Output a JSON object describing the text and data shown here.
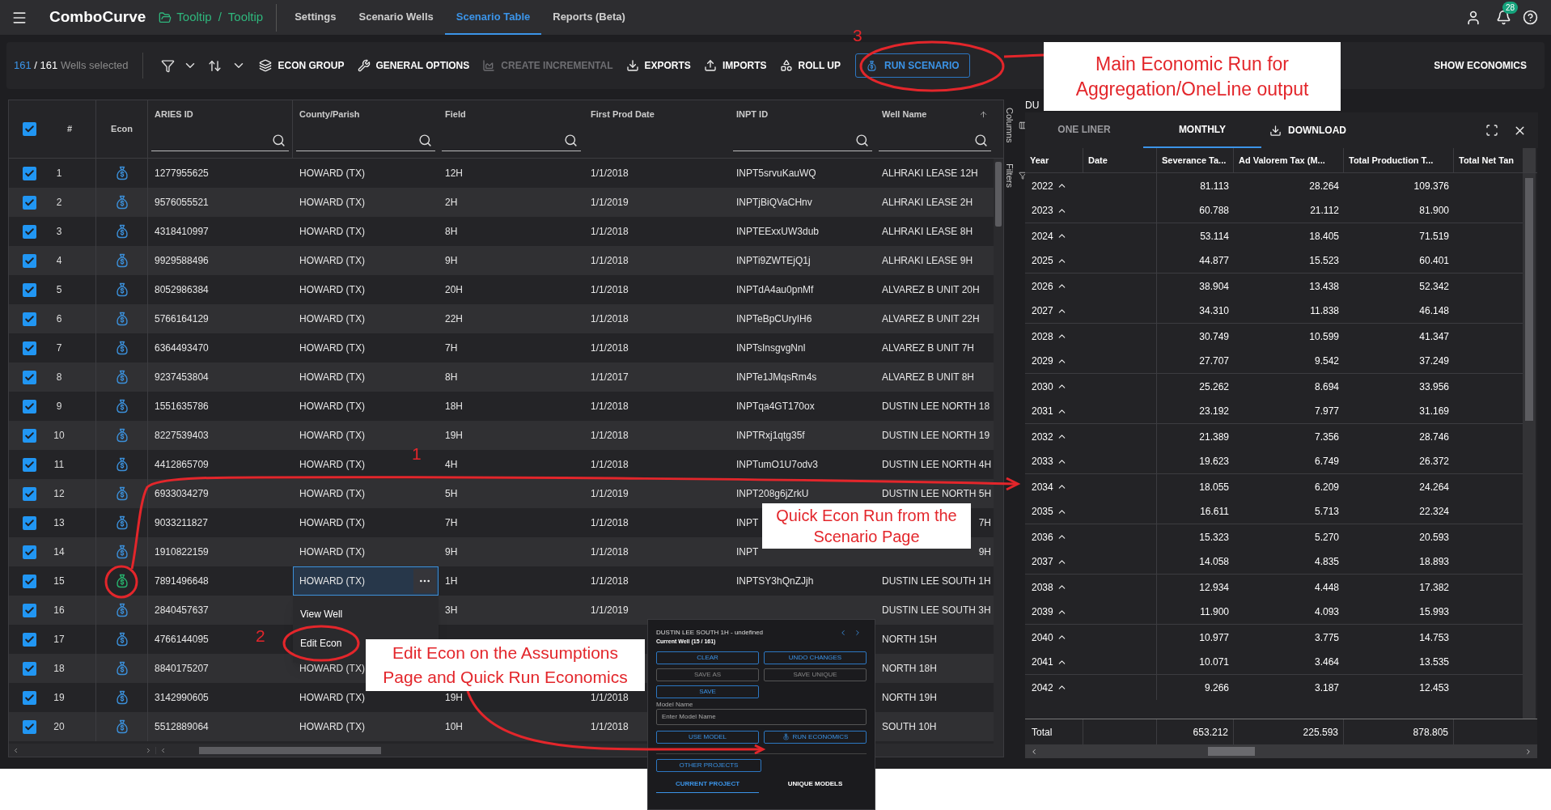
{
  "header": {
    "app_name": "ComboCurve",
    "breadcrumb": [
      "Tooltip",
      "Tooltip"
    ],
    "breadcrumb_separator": "/",
    "nav": [
      {
        "label": "Settings",
        "selected": false
      },
      {
        "label": "Scenario Wells",
        "selected": false
      },
      {
        "label": "Scenario Table",
        "selected": true
      },
      {
        "label": "Reports (Beta)",
        "selected": false
      }
    ],
    "notification_count": "28"
  },
  "toolbar": {
    "selected_count": "161",
    "separator": "/",
    "total": "161",
    "selected_label": "Wells selected",
    "actions": [
      {
        "label": "ECON GROUP",
        "kind": "layers",
        "disabled": false
      },
      {
        "label": "GENERAL OPTIONS",
        "kind": "wrench",
        "disabled": false
      },
      {
        "label": "CREATE INCREMENTAL",
        "kind": "chart",
        "disabled": true
      },
      {
        "label": "EXPORTS",
        "kind": "download",
        "disabled": false
      },
      {
        "label": "IMPORTS",
        "kind": "upload",
        "disabled": false
      },
      {
        "label": "ROLL UP",
        "kind": "shapes",
        "disabled": false
      }
    ],
    "run_button": "RUN SCENARIO",
    "show_economics": "SHOW ECONOMICS"
  },
  "table": {
    "all_checked": true,
    "columns": [
      {
        "label": "#",
        "search": false
      },
      {
        "label": "Econ",
        "search": false
      },
      {
        "label": "ARIES ID",
        "search": true
      },
      {
        "label": "County/Parish",
        "search": true
      },
      {
        "label": "Field",
        "search": true
      },
      {
        "label": "First Prod Date",
        "search": false
      },
      {
        "label": "INPT ID",
        "search": true
      },
      {
        "label": "Well Name",
        "search": true
      }
    ],
    "side_tabs": [
      "Columns",
      "Filters"
    ],
    "rows": [
      {
        "n": "1",
        "checked": true,
        "econ_active": false,
        "focused": false,
        "kind": "plain",
        "aries": "1277955625",
        "county": "HOWARD (TX)",
        "field": "12H",
        "date": "1/1/2018",
        "inpt": "INPT5srvuKauWQ",
        "well": "ALHRAKI LEASE 12H"
      },
      {
        "n": "2",
        "checked": true,
        "econ_active": false,
        "focused": false,
        "kind": "plain",
        "aries": "9576055521",
        "county": "HOWARD (TX)",
        "field": "2H",
        "date": "1/1/2019",
        "inpt": "INPTjBiQVaCHnv",
        "well": "ALHRAKI LEASE 2H"
      },
      {
        "n": "3",
        "checked": true,
        "econ_active": false,
        "focused": false,
        "kind": "plain",
        "aries": "4318410997",
        "county": "HOWARD (TX)",
        "field": "8H",
        "date": "1/1/2018",
        "inpt": "INPTEExxUW3dub",
        "well": "ALHRAKI LEASE 8H"
      },
      {
        "n": "4",
        "checked": true,
        "econ_active": false,
        "focused": false,
        "kind": "plain",
        "aries": "9929588496",
        "county": "HOWARD (TX)",
        "field": "9H",
        "date": "1/1/2018",
        "inpt": "INPTi9ZWTEjQ1j",
        "well": "ALHRAKI LEASE 9H"
      },
      {
        "n": "5",
        "checked": true,
        "econ_active": false,
        "focused": false,
        "kind": "plain",
        "aries": "8052986384",
        "county": "HOWARD (TX)",
        "field": "20H",
        "date": "1/1/2018",
        "inpt": "INPTdA4au0pnMf",
        "well": "ALVAREZ B UNIT 20H"
      },
      {
        "n": "6",
        "checked": true,
        "econ_active": false,
        "focused": false,
        "kind": "plain",
        "aries": "5766164129",
        "county": "HOWARD (TX)",
        "field": "22H",
        "date": "1/1/2018",
        "inpt": "INPTeBpCUryIH6",
        "well": "ALVAREZ B UNIT 22H"
      },
      {
        "n": "7",
        "checked": true,
        "econ_active": false,
        "focused": false,
        "kind": "plain",
        "aries": "6364493470",
        "county": "HOWARD (TX)",
        "field": "7H",
        "date": "1/1/2018",
        "inpt": "INPTsInsgvgNnl",
        "well": "ALVAREZ B UNIT 7H"
      },
      {
        "n": "8",
        "checked": true,
        "econ_active": false,
        "focused": false,
        "kind": "plain",
        "aries": "9237453804",
        "county": "HOWARD (TX)",
        "field": "8H",
        "date": "1/1/2017",
        "inpt": "INPTe1JMqsRm4s",
        "well": "ALVAREZ B UNIT 8H"
      },
      {
        "n": "9",
        "checked": true,
        "econ_active": false,
        "focused": false,
        "kind": "plain",
        "aries": "1551635786",
        "county": "HOWARD (TX)",
        "field": "18H",
        "date": "1/1/2018",
        "inpt": "INPTqa4GT170ox",
        "well": "DUSTIN LEE NORTH 18"
      },
      {
        "n": "10",
        "checked": true,
        "econ_active": false,
        "focused": false,
        "kind": "plain",
        "aries": "8227539403",
        "county": "HOWARD (TX)",
        "field": "19H",
        "date": "1/1/2018",
        "inpt": "INPTRxj1qtg35f",
        "well": "DUSTIN LEE NORTH 19"
      },
      {
        "n": "11",
        "checked": true,
        "econ_active": false,
        "focused": false,
        "kind": "plain",
        "aries": "4412865709",
        "county": "HOWARD (TX)",
        "field": "4H",
        "date": "1/1/2018",
        "inpt": "INPTumO1U7odv3",
        "well": "DUSTIN LEE NORTH 4H"
      },
      {
        "n": "12",
        "checked": true,
        "econ_active": false,
        "focused": false,
        "kind": "plain",
        "aries": "6933034279",
        "county": "HOWARD (TX)",
        "field": "5H",
        "date": "1/1/2019",
        "inpt": "INPT208g6jZrkU",
        "well": "DUSTIN LEE NORTH 5H"
      },
      {
        "n": "13",
        "checked": true,
        "econ_active": false,
        "focused": false,
        "kind": "covered",
        "aries": "9033211827",
        "county": "HOWARD (TX)",
        "field": "7H",
        "date": "1/1/2018",
        "inpt": "INPT",
        "well": "7H"
      },
      {
        "n": "14",
        "checked": true,
        "econ_active": false,
        "focused": false,
        "kind": "covered",
        "aries": "1910822159",
        "county": "HOWARD (TX)",
        "field": "9H",
        "date": "1/1/2018",
        "inpt": "INPT",
        "well": "9H"
      },
      {
        "n": "15",
        "checked": true,
        "econ_active": true,
        "focused": true,
        "kind": "plain",
        "aries": "7891496648",
        "county": "HOWARD (TX)",
        "field": "1H",
        "date": "1/1/2018",
        "inpt": "INPTSY3hQnZJjh",
        "well": "DUSTIN LEE SOUTH 1H"
      },
      {
        "n": "16",
        "checked": true,
        "econ_active": false,
        "focused": false,
        "kind": "plain",
        "aries": "2840457637",
        "field": "3H",
        "date": "1/1/2019",
        "well": "DUSTIN LEE SOUTH 3H"
      },
      {
        "n": "17",
        "checked": true,
        "econ_active": false,
        "focused": false,
        "kind": "plain",
        "aries": "4766144095",
        "well": "NORTH 15H"
      },
      {
        "n": "18",
        "checked": true,
        "econ_active": false,
        "focused": false,
        "kind": "plain",
        "aries": "8840175207",
        "county": "HOWARD (TX)",
        "well": "NORTH 18H"
      },
      {
        "n": "19",
        "checked": true,
        "econ_active": false,
        "focused": false,
        "kind": "plain",
        "aries": "3142990605",
        "county": "HOWARD (TX)",
        "field": "19H",
        "date": "1/1/2018",
        "well": "NORTH 19H"
      },
      {
        "n": "20",
        "checked": true,
        "econ_active": false,
        "focused": false,
        "kind": "plain",
        "aries": "5512889064",
        "county": "HOWARD (TX)",
        "field": "10H",
        "date": "1/1/2018",
        "well": "SOUTH 10H"
      }
    ]
  },
  "context_menu": {
    "items": [
      "View Well",
      "Edit Econ"
    ]
  },
  "panel": {
    "title": "DU",
    "tabs": [
      {
        "label": "ONE LINER",
        "selected": false
      },
      {
        "label": "MONTHLY",
        "selected": true
      }
    ],
    "download": "DOWNLOAD",
    "columns": [
      "Year",
      "Date",
      "Severance Ta...",
      "Ad Valorem Tax (M...",
      "Total Production T...",
      "Total Net Tan"
    ],
    "rows": [
      {
        "year": "2022",
        "values": [
          "81.113",
          "28.264",
          "109.376"
        ]
      },
      {
        "year": "2023",
        "values": [
          "60.788",
          "21.112",
          "81.900"
        ]
      },
      {
        "year": "2024",
        "values": [
          "53.114",
          "18.405",
          "71.519"
        ]
      },
      {
        "year": "2025",
        "values": [
          "44.877",
          "15.523",
          "60.401"
        ]
      },
      {
        "year": "2026",
        "values": [
          "38.904",
          "13.438",
          "52.342"
        ]
      },
      {
        "year": "2027",
        "values": [
          "34.310",
          "11.838",
          "46.148"
        ]
      },
      {
        "year": "2028",
        "values": [
          "30.749",
          "10.599",
          "41.347"
        ]
      },
      {
        "year": "2029",
        "values": [
          "27.707",
          "9.542",
          "37.249"
        ]
      },
      {
        "year": "2030",
        "values": [
          "25.262",
          "8.694",
          "33.956"
        ]
      },
      {
        "year": "2031",
        "values": [
          "23.192",
          "7.977",
          "31.169"
        ]
      },
      {
        "year": "2032",
        "values": [
          "21.389",
          "7.356",
          "28.746"
        ]
      },
      {
        "year": "2033",
        "values": [
          "19.623",
          "6.749",
          "26.372"
        ]
      },
      {
        "year": "2034",
        "values": [
          "18.055",
          "6.209",
          "24.264"
        ]
      },
      {
        "year": "2035",
        "values": [
          "16.611",
          "5.713",
          "22.324"
        ]
      },
      {
        "year": "2036",
        "values": [
          "15.323",
          "5.270",
          "20.593"
        ]
      },
      {
        "year": "2037",
        "values": [
          "14.058",
          "4.835",
          "18.893"
        ]
      },
      {
        "year": "2038",
        "values": [
          "12.934",
          "4.448",
          "17.382"
        ]
      },
      {
        "year": "2039",
        "values": [
          "11.900",
          "4.093",
          "15.993"
        ]
      },
      {
        "year": "2040",
        "values": [
          "10.977",
          "3.775",
          "14.753"
        ]
      },
      {
        "year": "2041",
        "values": [
          "10.071",
          "3.464",
          "13.535"
        ]
      },
      {
        "year": "2042",
        "values": [
          "9.266",
          "3.187",
          "12.453"
        ]
      }
    ],
    "total": {
      "label": "Total",
      "values": [
        "653.212",
        "225.593",
        "878.805"
      ]
    }
  },
  "popup": {
    "title": "DUSTIN LEE SOUTH 1H - undefined",
    "subtitle": "Current Well (15 / 161)",
    "buttons": [
      {
        "label": "CLEAR",
        "disabled": false
      },
      {
        "label": "UNDO CHANGES",
        "disabled": false
      },
      {
        "label": "SAVE AS",
        "disabled": true
      },
      {
        "label": "SAVE UNIQUE",
        "disabled": true
      },
      {
        "label": "SAVE",
        "disabled": false
      }
    ],
    "model_name_label": "Model Name",
    "model_name_placeholder": "Enter Model Name",
    "use_model": "USE MODEL",
    "run_economics": "RUN ECONOMICS",
    "other_projects": "OTHER PROJECTS",
    "tabs": [
      {
        "label": "CURRENT PROJECT",
        "selected": true
      },
      {
        "label": "UNIQUE MODELS",
        "selected": false
      }
    ]
  },
  "annotations": {
    "numbers": [
      "1",
      "2",
      "3"
    ],
    "callouts": [
      "Main Economic Run for Aggregation/OneLine output",
      "Quick Econ Run from the Scenario Page",
      "Edit Econ on the Assumptions Page and Quick Run Economics"
    ]
  }
}
